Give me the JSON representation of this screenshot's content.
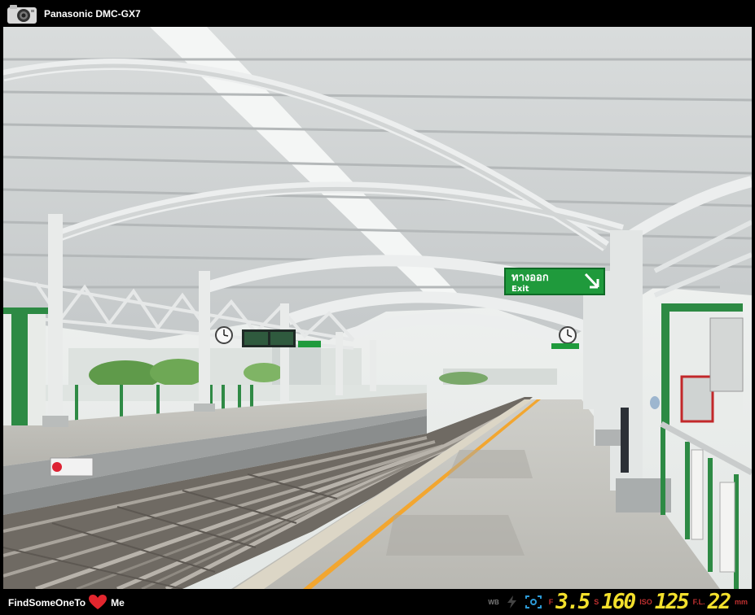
{
  "camera": {
    "model": "Panasonic DMC-GX7",
    "icon": "camera-icon"
  },
  "photo": {
    "sign_exit_thai": "ทางออก",
    "sign_exit_en": "Exit",
    "colors": {
      "roof": "#e4e6e4",
      "sign_green": "#1f9a3c",
      "platform": "#bdbdb8",
      "sky": "#f2f4f2"
    }
  },
  "footer": {
    "brand_left": "FindSomeOneTo",
    "brand_right": "Me",
    "heart_icon": "heart-icon",
    "exif": {
      "wb": "WB",
      "flash_icon": "flash-icon",
      "metering_icon": "metering-icon",
      "aperture_label": "F",
      "aperture_value": "3.5",
      "shutter_label": "S",
      "shutter_value": "160",
      "iso_label": "ISO",
      "iso_value": "125",
      "focal_label": "F.L.",
      "focal_value": "22",
      "focal_unit": "mm"
    }
  }
}
